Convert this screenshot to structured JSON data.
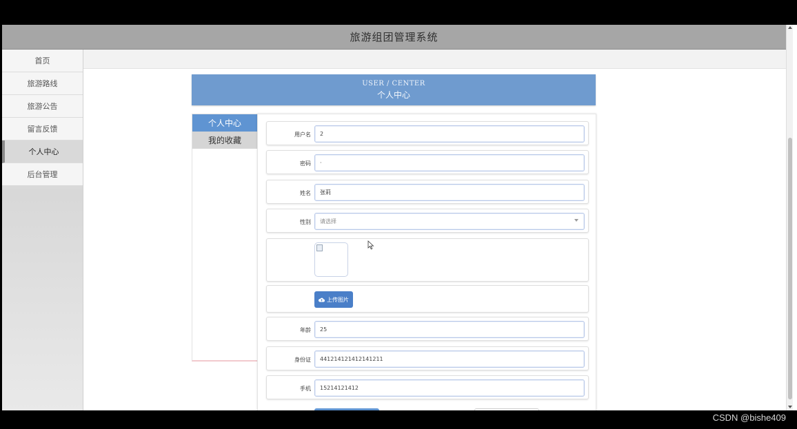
{
  "app": {
    "title": "旅游组团管理系统"
  },
  "sidebar": {
    "items": [
      {
        "label": "首页",
        "active": false
      },
      {
        "label": "旅游路线",
        "active": false
      },
      {
        "label": "旅游公告",
        "active": false
      },
      {
        "label": "留言反馈",
        "active": false
      },
      {
        "label": "个人中心",
        "active": true
      },
      {
        "label": "后台管理",
        "active": false
      }
    ]
  },
  "banner": {
    "en": "USER / CENTER",
    "cn": "个人中心"
  },
  "tabs": [
    {
      "label": "个人中心",
      "active": true
    },
    {
      "label": "我的收藏",
      "active": false
    }
  ],
  "form": {
    "username": {
      "label": "用户名",
      "value": "2"
    },
    "password": {
      "label": "密码",
      "value": "·"
    },
    "name": {
      "label": "姓名",
      "value": "张莉"
    },
    "gender": {
      "label": "性别",
      "placeholder": "请选择"
    },
    "upload_button": {
      "label": "上传图片",
      "icon": "cloud-upload-icon"
    },
    "age": {
      "label": "年龄",
      "value": "25"
    },
    "id_card": {
      "label": "身份证",
      "value": "441214121412141211"
    },
    "phone": {
      "label": "手机",
      "value": "15214121412"
    }
  },
  "watermark": "CSDN @bishe409",
  "colors": {
    "banner": "#6f9bcf",
    "active_tab": "#5f94d2",
    "header": "#a6a6a6",
    "upload_button": "#4a7fc8"
  }
}
